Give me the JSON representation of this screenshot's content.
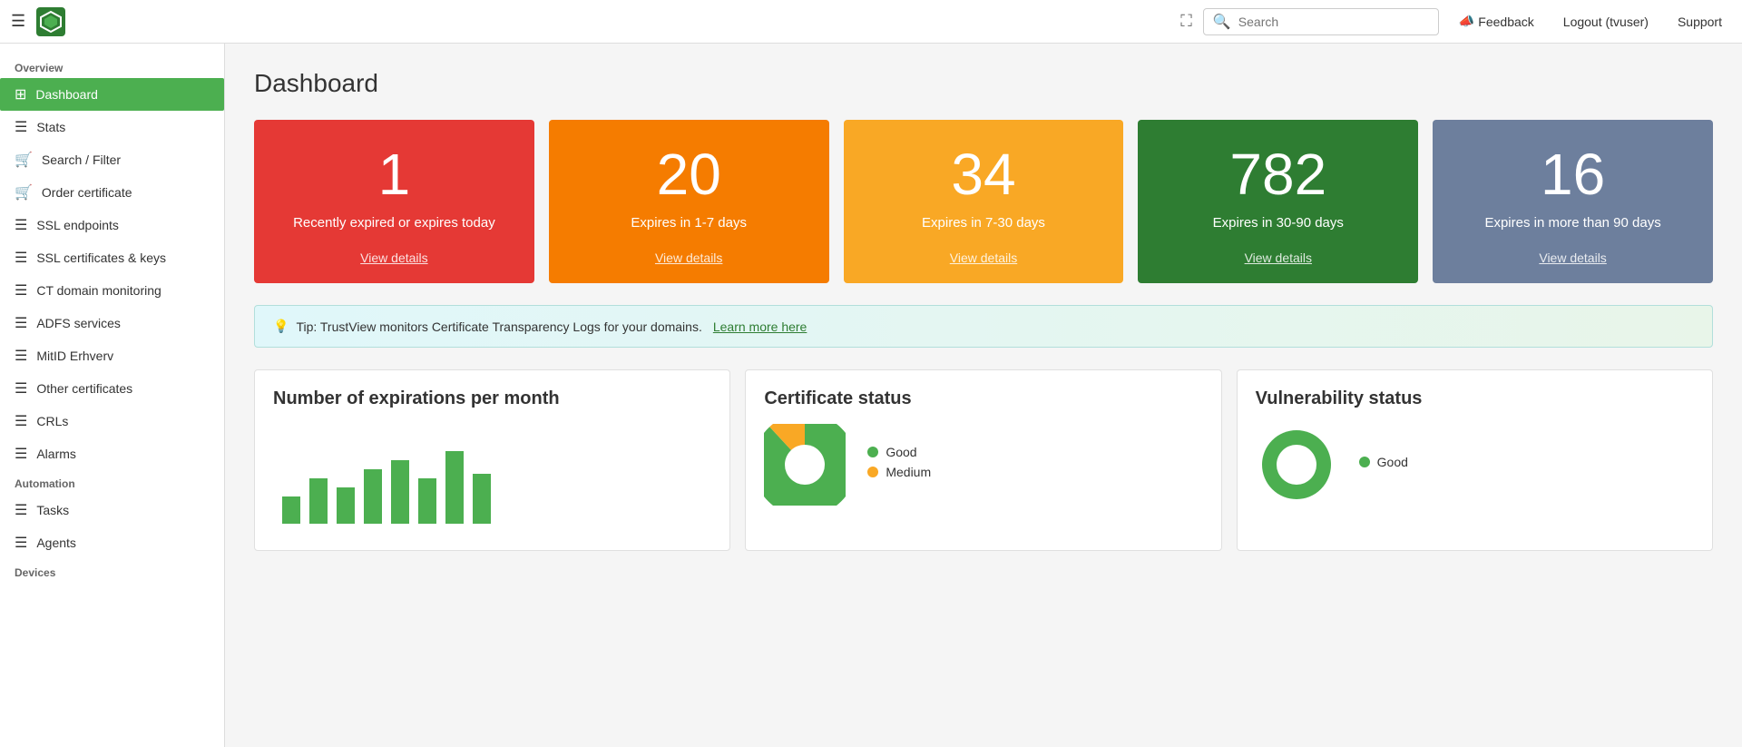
{
  "topnav": {
    "search_placeholder": "Search",
    "feedback_label": "Feedback",
    "logout_label": "Logout (tvuser)",
    "support_label": "Support"
  },
  "sidebar": {
    "overview_label": "Overview",
    "automation_label": "Automation",
    "devices_label": "Devices",
    "items": [
      {
        "id": "dashboard",
        "label": "Dashboard",
        "active": true
      },
      {
        "id": "stats",
        "label": "Stats",
        "active": false
      },
      {
        "id": "search-filter",
        "label": "Search / Filter",
        "active": false
      },
      {
        "id": "order-certificate",
        "label": "Order certificate",
        "active": false
      },
      {
        "id": "ssl-endpoints",
        "label": "SSL endpoints",
        "active": false
      },
      {
        "id": "ssl-certificates-keys",
        "label": "SSL certificates & keys",
        "active": false
      },
      {
        "id": "ct-domain-monitoring",
        "label": "CT domain monitoring",
        "active": false
      },
      {
        "id": "adfs-services",
        "label": "ADFS services",
        "active": false
      },
      {
        "id": "mitid-erhverv",
        "label": "MitID Erhverv",
        "active": false
      },
      {
        "id": "other-certificates",
        "label": "Other certificates",
        "active": false
      },
      {
        "id": "crls",
        "label": "CRLs",
        "active": false
      },
      {
        "id": "alarms",
        "label": "Alarms",
        "active": false
      }
    ],
    "automation_items": [
      {
        "id": "tasks",
        "label": "Tasks",
        "active": false
      },
      {
        "id": "agents",
        "label": "Agents",
        "active": false
      }
    ]
  },
  "dashboard": {
    "title": "Dashboard",
    "cards": [
      {
        "id": "expired",
        "number": "1",
        "label": "Recently expired or expires today",
        "link": "View details",
        "color": "red"
      },
      {
        "id": "1-7days",
        "number": "20",
        "label": "Expires in 1-7 days",
        "link": "View details",
        "color": "orange"
      },
      {
        "id": "7-30days",
        "number": "34",
        "label": "Expires in 7-30 days",
        "link": "View details",
        "color": "yellow"
      },
      {
        "id": "30-90days",
        "number": "782",
        "label": "Expires in 30-90 days",
        "link": "View details",
        "color": "green"
      },
      {
        "id": "90plusdays",
        "number": "16",
        "label": "Expires in more than 90 days",
        "link": "View details",
        "color": "blue"
      }
    ],
    "tip_text": "Tip: TrustView monitors Certificate Transparency Logs for your domains.",
    "tip_link": "Learn more here",
    "panels": [
      {
        "id": "expirations",
        "title": "Number of expirations per month"
      },
      {
        "id": "cert-status",
        "title": "Certificate status",
        "legend": [
          {
            "label": "Good",
            "color": "green"
          },
          {
            "label": "Medium",
            "color": "yellow"
          }
        ]
      },
      {
        "id": "vuln-status",
        "title": "Vulnerability status",
        "legend": [
          {
            "label": "Good",
            "color": "green"
          }
        ]
      }
    ]
  }
}
